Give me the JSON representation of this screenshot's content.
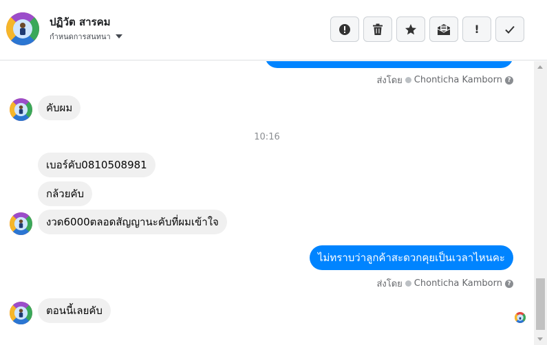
{
  "header": {
    "name": "ปฏิวัต สารคม",
    "subtitle": "กำหนดการสนทนา",
    "actions": [
      {
        "name": "report-button",
        "icon": "exclamation-circle-icon",
        "glyph": ""
      },
      {
        "name": "delete-button",
        "icon": "trash-icon",
        "glyph": ""
      },
      {
        "name": "star-button",
        "icon": "star-icon",
        "glyph": ""
      },
      {
        "name": "mark-unread-button",
        "icon": "envelope-icon",
        "glyph": ""
      },
      {
        "name": "mark-important-button",
        "icon": "exclamation-icon",
        "glyph": "!"
      },
      {
        "name": "mark-done-button",
        "icon": "check-icon",
        "glyph": ""
      }
    ]
  },
  "thread": {
    "sent_by_prefix": "ส่งโดย",
    "agent_name": "Chonticha Kamborn",
    "help_glyph": "?",
    "time_divider": "10:16",
    "messages": [
      {
        "text": "คับผม"
      },
      {
        "text": "เบอร์คับ0810508981"
      },
      {
        "text": "กล้วยคับ"
      },
      {
        "text": "งวด6000ตลอดสัญญานะคับที่ผมเข้าใจ"
      },
      {
        "text": "ไม่ทราบว่าลูกค้าสะดวกคุยเป็นเวลาไหนคะ"
      },
      {
        "text": "ตอนนี้เลยคับ"
      }
    ]
  },
  "colors": {
    "outgoing_bubble": "#0084ff",
    "incoming_bubble": "#f0f0f0",
    "meta_text": "#65676b"
  }
}
